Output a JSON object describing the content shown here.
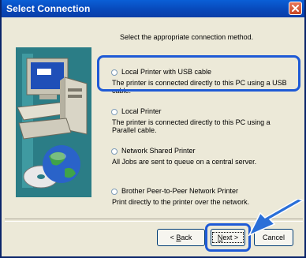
{
  "window": {
    "title": "Select Connection"
  },
  "instruction": "Select the appropriate connection method.",
  "options": [
    {
      "label": "Local Printer with USB cable",
      "description": "The printer is connected directly to this PC using a USB cable.",
      "selected": false
    },
    {
      "label": "Local Printer",
      "description": "The printer is connected directly to this PC using a Parallel cable.",
      "selected": false
    },
    {
      "label": "Network Shared Printer",
      "description": "All Jobs are sent to queue on a central server.",
      "selected": false
    },
    {
      "label": "Brother Peer-to-Peer Network Printer",
      "description": "Print directly to the printer over the network.",
      "selected": false
    }
  ],
  "buttons": {
    "back_prefix": "< ",
    "back_accel": "B",
    "back_rest": "ack",
    "next_accel": "N",
    "next_rest": "ext >",
    "cancel": "Cancel"
  },
  "colors": {
    "titlebar": "#0a4fc8",
    "dialog_bg": "#ece9d8",
    "highlight": "#1e5ad6",
    "panel": "#2b7d86"
  },
  "icons": [
    "close-icon",
    "computer-illustration",
    "globe-disk-illustration",
    "pointer-arrow"
  ]
}
